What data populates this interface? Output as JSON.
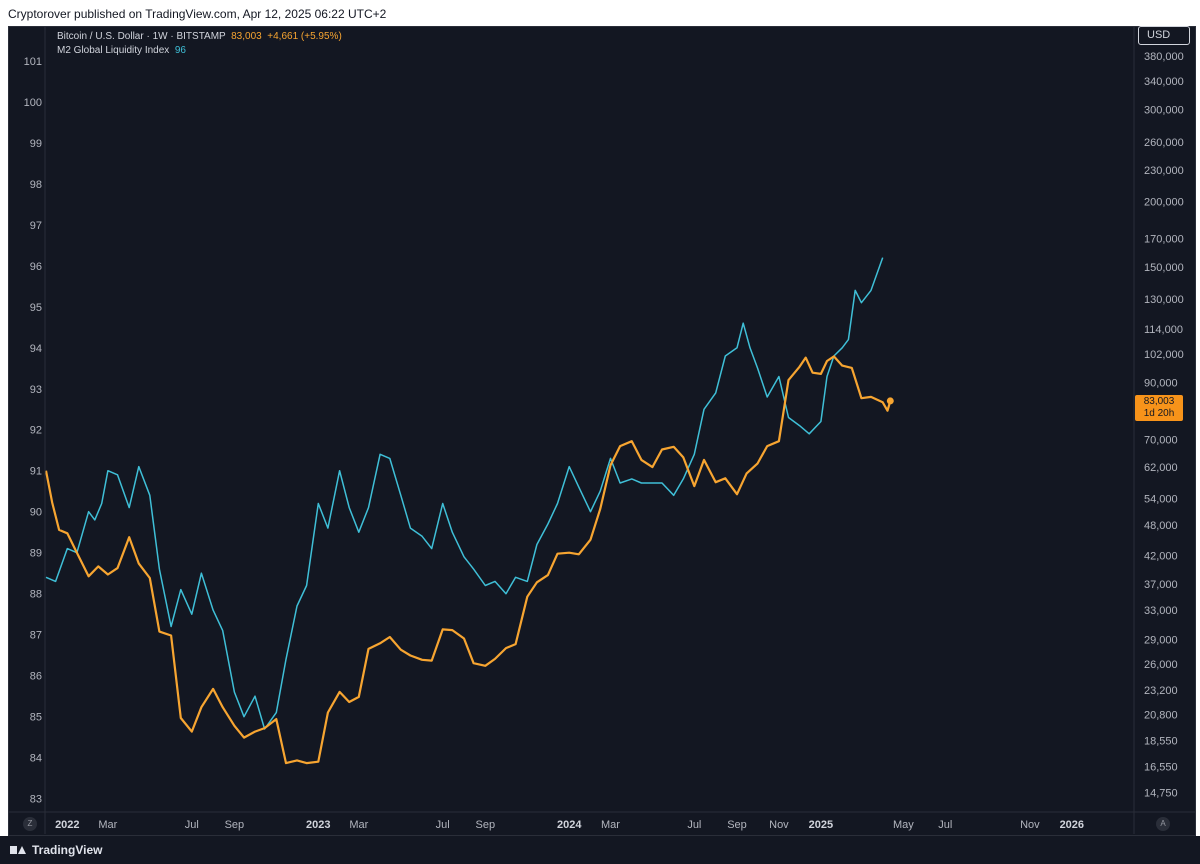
{
  "header": {
    "published_text": "Cryptorover published on TradingView.com, Apr 12, 2025 06:22 UTC+2"
  },
  "legend": {
    "btc_label": "Bitcoin / U.S. Dollar · 1W · BITSTAMP",
    "btc_value": "83,003",
    "btc_change": "+4,661 (+5.95%)",
    "m2_label": "M2 Global Liquidity Index",
    "m2_value": "96"
  },
  "price_axis": {
    "currency_label": "USD"
  },
  "price_tag": {
    "value": "83,003",
    "countdown": "1d 20h"
  },
  "buttons": {
    "auto_scale": "A",
    "zoom": "Z"
  },
  "footer": {
    "brand": "TradingView"
  },
  "colors": {
    "background": "#131722",
    "btc": "#f7a531",
    "m2": "#3fbfd7",
    "text": "#d1d4dc"
  },
  "chart_data": {
    "type": "line",
    "x_range": [
      "2021-12-01",
      "2026-03-31"
    ],
    "left_axis": {
      "ticks": [
        83,
        84,
        85,
        86,
        87,
        88,
        89,
        90,
        91,
        92,
        93,
        94,
        95,
        96,
        97,
        98,
        99,
        100,
        101
      ],
      "range": [
        82.7,
        101.8
      ]
    },
    "right_axis": {
      "scale": "log",
      "ticks": [
        14750,
        16550,
        18550,
        20800,
        23200,
        26000,
        29000,
        33000,
        37000,
        42000,
        48000,
        54000,
        62000,
        70000,
        80000,
        90000,
        102000,
        114000,
        130000,
        150000,
        170000,
        200000,
        230000,
        260000,
        300000,
        340000,
        380000
      ],
      "tick_labels": [
        "14,750",
        "16,550",
        "18,550",
        "20,800",
        "23,200",
        "26,000",
        "29,000",
        "33,000",
        "37,000",
        "42,000",
        "48,000",
        "54,000",
        "62,000",
        "70,000",
        "80,000",
        "90,000",
        "102,000",
        "114,000",
        "130,000",
        "150,000",
        "170,000",
        "200,000",
        "230,000",
        "260,000",
        "300,000",
        "340,000",
        "380,000"
      ]
    },
    "x_ticks": [
      {
        "date": "2022-01-01",
        "label": "2022",
        "bold": true
      },
      {
        "date": "2022-03-01",
        "label": "Mar"
      },
      {
        "date": "2022-07-01",
        "label": "Jul"
      },
      {
        "date": "2022-09-01",
        "label": "Sep"
      },
      {
        "date": "2023-01-01",
        "label": "2023",
        "bold": true
      },
      {
        "date": "2023-03-01",
        "label": "Mar"
      },
      {
        "date": "2023-07-01",
        "label": "Jul"
      },
      {
        "date": "2023-09-01",
        "label": "Sep"
      },
      {
        "date": "2024-01-01",
        "label": "2024",
        "bold": true
      },
      {
        "date": "2024-03-01",
        "label": "Mar"
      },
      {
        "date": "2024-07-01",
        "label": "Jul"
      },
      {
        "date": "2024-09-01",
        "label": "Sep"
      },
      {
        "date": "2024-11-01",
        "label": "Nov"
      },
      {
        "date": "2025-01-01",
        "label": "2025",
        "bold": true
      },
      {
        "date": "2025-05-01",
        "label": "May"
      },
      {
        "date": "2025-07-01",
        "label": "Jul"
      },
      {
        "date": "2025-11-01",
        "label": "Nov"
      },
      {
        "date": "2026-01-01",
        "label": "2026",
        "bold": true
      }
    ],
    "series": [
      {
        "name": "M2 Global Liquidity Index",
        "axis": "left",
        "color": "#3fbfd7",
        "points": [
          [
            "2021-12-01",
            88.4
          ],
          [
            "2021-12-15",
            88.3
          ],
          [
            "2022-01-01",
            89.1
          ],
          [
            "2022-01-15",
            89.0
          ],
          [
            "2022-02-01",
            90.0
          ],
          [
            "2022-02-10",
            89.8
          ],
          [
            "2022-02-20",
            90.2
          ],
          [
            "2022-03-01",
            91.0
          ],
          [
            "2022-03-15",
            90.9
          ],
          [
            "2022-04-01",
            90.1
          ],
          [
            "2022-04-15",
            91.1
          ],
          [
            "2022-05-01",
            90.4
          ],
          [
            "2022-05-15",
            88.6
          ],
          [
            "2022-06-01",
            87.2
          ],
          [
            "2022-06-15",
            88.1
          ],
          [
            "2022-07-01",
            87.5
          ],
          [
            "2022-07-15",
            88.5
          ],
          [
            "2022-08-01",
            87.6
          ],
          [
            "2022-08-15",
            87.1
          ],
          [
            "2022-09-01",
            85.6
          ],
          [
            "2022-09-15",
            85.0
          ],
          [
            "2022-10-01",
            85.5
          ],
          [
            "2022-10-15",
            84.7
          ],
          [
            "2022-11-01",
            85.1
          ],
          [
            "2022-11-15",
            86.4
          ],
          [
            "2022-12-01",
            87.7
          ],
          [
            "2022-12-15",
            88.2
          ],
          [
            "2023-01-01",
            90.2
          ],
          [
            "2023-01-15",
            89.6
          ],
          [
            "2023-02-01",
            91.0
          ],
          [
            "2023-02-15",
            90.1
          ],
          [
            "2023-03-01",
            89.5
          ],
          [
            "2023-03-15",
            90.1
          ],
          [
            "2023-04-01",
            91.4
          ],
          [
            "2023-04-15",
            91.3
          ],
          [
            "2023-05-01",
            90.4
          ],
          [
            "2023-05-15",
            89.6
          ],
          [
            "2023-06-01",
            89.4
          ],
          [
            "2023-06-15",
            89.1
          ],
          [
            "2023-07-01",
            90.2
          ],
          [
            "2023-07-15",
            89.5
          ],
          [
            "2023-08-01",
            88.9
          ],
          [
            "2023-08-15",
            88.6
          ],
          [
            "2023-09-01",
            88.2
          ],
          [
            "2023-09-15",
            88.3
          ],
          [
            "2023-10-01",
            88.0
          ],
          [
            "2023-10-15",
            88.4
          ],
          [
            "2023-11-01",
            88.3
          ],
          [
            "2023-11-15",
            89.2
          ],
          [
            "2023-12-01",
            89.7
          ],
          [
            "2023-12-15",
            90.2
          ],
          [
            "2024-01-01",
            91.1
          ],
          [
            "2024-01-15",
            90.6
          ],
          [
            "2024-02-01",
            90.0
          ],
          [
            "2024-02-15",
            90.5
          ],
          [
            "2024-03-01",
            91.3
          ],
          [
            "2024-03-15",
            90.7
          ],
          [
            "2024-04-01",
            90.8
          ],
          [
            "2024-04-15",
            90.7
          ],
          [
            "2024-05-01",
            90.7
          ],
          [
            "2024-05-15",
            90.7
          ],
          [
            "2024-06-01",
            90.4
          ],
          [
            "2024-06-15",
            90.8
          ],
          [
            "2024-07-01",
            91.4
          ],
          [
            "2024-07-15",
            92.5
          ],
          [
            "2024-08-01",
            92.9
          ],
          [
            "2024-08-15",
            93.8
          ],
          [
            "2024-09-01",
            94.0
          ],
          [
            "2024-09-10",
            94.6
          ],
          [
            "2024-09-20",
            94.0
          ],
          [
            "2024-10-01",
            93.5
          ],
          [
            "2024-10-15",
            92.8
          ],
          [
            "2024-11-01",
            93.3
          ],
          [
            "2024-11-15",
            92.3
          ],
          [
            "2024-12-01",
            92.1
          ],
          [
            "2024-12-15",
            91.9
          ],
          [
            "2025-01-01",
            92.2
          ],
          [
            "2025-01-10",
            93.3
          ],
          [
            "2025-01-20",
            93.8
          ],
          [
            "2025-02-01",
            94.0
          ],
          [
            "2025-02-10",
            94.2
          ],
          [
            "2025-02-20",
            95.4
          ],
          [
            "2025-03-01",
            95.1
          ],
          [
            "2025-03-15",
            95.4
          ],
          [
            "2025-04-01",
            96.2
          ]
        ]
      },
      {
        "name": "Bitcoin / U.S. Dollar · 1W · BITSTAMP",
        "axis": "right",
        "color": "#f7a531",
        "points": [
          [
            "2021-12-01",
            61000
          ],
          [
            "2021-12-10",
            53000
          ],
          [
            "2021-12-20",
            47000
          ],
          [
            "2022-01-01",
            46300
          ],
          [
            "2022-01-15",
            42500
          ],
          [
            "2022-02-01",
            38300
          ],
          [
            "2022-02-15",
            40000
          ],
          [
            "2022-03-01",
            38600
          ],
          [
            "2022-03-15",
            39700
          ],
          [
            "2022-04-01",
            45500
          ],
          [
            "2022-04-15",
            40500
          ],
          [
            "2022-05-01",
            38000
          ],
          [
            "2022-05-15",
            30000
          ],
          [
            "2022-06-01",
            29500
          ],
          [
            "2022-06-15",
            20500
          ],
          [
            "2022-07-01",
            19300
          ],
          [
            "2022-07-15",
            21500
          ],
          [
            "2022-08-01",
            23300
          ],
          [
            "2022-08-15",
            21500
          ],
          [
            "2022-09-01",
            19800
          ],
          [
            "2022-09-15",
            18800
          ],
          [
            "2022-10-01",
            19300
          ],
          [
            "2022-10-15",
            19600
          ],
          [
            "2022-11-01",
            20400
          ],
          [
            "2022-11-15",
            16800
          ],
          [
            "2022-12-01",
            17000
          ],
          [
            "2022-12-15",
            16800
          ],
          [
            "2023-01-01",
            16900
          ],
          [
            "2023-01-15",
            21000
          ],
          [
            "2023-02-01",
            23000
          ],
          [
            "2023-02-15",
            22000
          ],
          [
            "2023-03-01",
            22500
          ],
          [
            "2023-03-15",
            27800
          ],
          [
            "2023-04-01",
            28500
          ],
          [
            "2023-04-15",
            29300
          ],
          [
            "2023-05-01",
            27700
          ],
          [
            "2023-05-15",
            27000
          ],
          [
            "2023-06-01",
            26500
          ],
          [
            "2023-06-15",
            26400
          ],
          [
            "2023-07-01",
            30300
          ],
          [
            "2023-07-15",
            30200
          ],
          [
            "2023-08-01",
            29100
          ],
          [
            "2023-08-15",
            26100
          ],
          [
            "2023-09-01",
            25800
          ],
          [
            "2023-09-15",
            26600
          ],
          [
            "2023-10-01",
            27900
          ],
          [
            "2023-10-15",
            28400
          ],
          [
            "2023-11-01",
            35000
          ],
          [
            "2023-11-15",
            37300
          ],
          [
            "2023-12-01",
            38500
          ],
          [
            "2023-12-15",
            42300
          ],
          [
            "2024-01-01",
            42500
          ],
          [
            "2024-01-15",
            42200
          ],
          [
            "2024-02-01",
            45000
          ],
          [
            "2024-02-15",
            51500
          ],
          [
            "2024-03-01",
            62500
          ],
          [
            "2024-03-15",
            68000
          ],
          [
            "2024-04-01",
            69500
          ],
          [
            "2024-04-15",
            64000
          ],
          [
            "2024-05-01",
            62000
          ],
          [
            "2024-05-15",
            67000
          ],
          [
            "2024-06-01",
            67800
          ],
          [
            "2024-06-15",
            64700
          ],
          [
            "2024-07-01",
            57000
          ],
          [
            "2024-07-15",
            64000
          ],
          [
            "2024-08-01",
            58000
          ],
          [
            "2024-08-15",
            59000
          ],
          [
            "2024-09-01",
            55000
          ],
          [
            "2024-09-15",
            60300
          ],
          [
            "2024-10-01",
            63000
          ],
          [
            "2024-10-15",
            68000
          ],
          [
            "2024-11-01",
            69500
          ],
          [
            "2024-11-15",
            91000
          ],
          [
            "2024-12-01",
            96500
          ],
          [
            "2024-12-10",
            100500
          ],
          [
            "2024-12-20",
            94000
          ],
          [
            "2025-01-01",
            93500
          ],
          [
            "2025-01-10",
            99000
          ],
          [
            "2025-01-20",
            101000
          ],
          [
            "2025-02-01",
            97000
          ],
          [
            "2025-02-15",
            96000
          ],
          [
            "2025-03-01",
            84000
          ],
          [
            "2025-03-15",
            84500
          ],
          [
            "2025-04-01",
            82500
          ],
          [
            "2025-04-08",
            79500
          ],
          [
            "2025-04-12",
            83003
          ]
        ]
      }
    ]
  }
}
